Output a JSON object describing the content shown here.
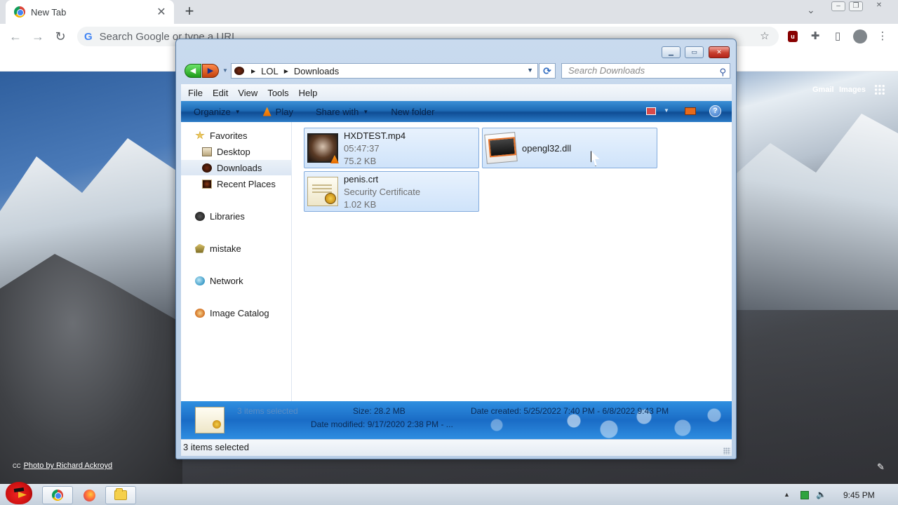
{
  "browser": {
    "tab_title": "New Tab",
    "omnibox_placeholder": "Search Google or type a URL",
    "page_links": {
      "gmail": "Gmail",
      "images": "Images"
    },
    "photo_credit": "Photo by Richard Ackroyd"
  },
  "explorer": {
    "breadcrumb": [
      "LOL",
      "Downloads"
    ],
    "search_placeholder": "Search Downloads",
    "menu": [
      "File",
      "Edit",
      "View",
      "Tools",
      "Help"
    ],
    "commands": {
      "organize": "Organize",
      "play": "Play",
      "share_with": "Share with",
      "new_folder": "New folder"
    },
    "nav": {
      "favorites": "Favorites",
      "desktop": "Desktop",
      "downloads": "Downloads",
      "recent_places": "Recent Places",
      "libraries": "Libraries",
      "user": "mistake",
      "network": "Network",
      "image_catalog": "Image Catalog"
    },
    "files": [
      {
        "name": "HXDTEST.mp4",
        "line2": "05:47:37",
        "line3": "75.2 KB"
      },
      {
        "name": "opengl32.dll"
      },
      {
        "name": "penis.crt",
        "line2": "Security Certificate",
        "line3": "1.02 KB"
      }
    ],
    "details": {
      "count": "3 items selected",
      "size": "Size: 28.2 MB",
      "date_created": "Date created: 5/25/2022 7:40 PM - 6/8/2022 9:43 PM",
      "date_modified": "Date modified: 9/17/2020 2:38 PM - ..."
    },
    "status": "3 items selected"
  },
  "taskbar": {
    "clock": "9:45 PM"
  },
  "colors": {
    "accent": "#1e6bb5",
    "tile_selected": "#cfe3fa",
    "close": "#c8402f"
  }
}
